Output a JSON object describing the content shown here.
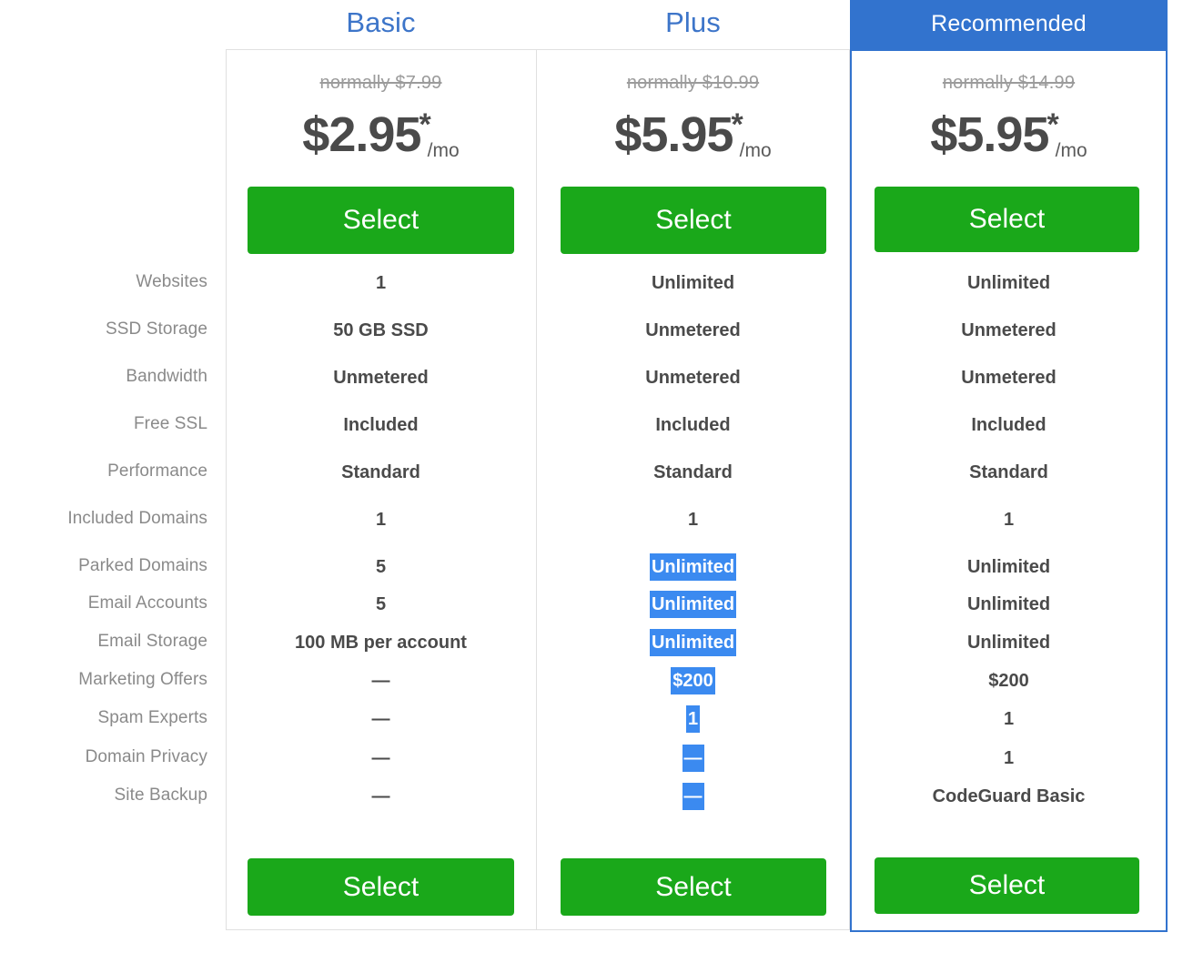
{
  "colors": {
    "brand_blue": "#3273ce",
    "title_blue": "#3d75c9",
    "select_green": "#1aa81a",
    "selection_highlight": "#3b8af0",
    "label_gray": "#8a8a8a",
    "value_gray": "#4a4a4a",
    "strike_gray": "#9b9b9b"
  },
  "plans": [
    {
      "id": "basic",
      "title": "Basic",
      "header_style": "plain",
      "normally": "normally $7.99",
      "price": "$2.95",
      "star": "*",
      "per": "/mo",
      "select_top_label": "Select",
      "select_bottom_label": "Select"
    },
    {
      "id": "plus",
      "title": "Plus",
      "header_style": "plain",
      "normally": "normally $10.99",
      "price": "$5.95",
      "star": "*",
      "per": "/mo",
      "select_top_label": "Select",
      "select_bottom_label": "Select"
    },
    {
      "id": "recommended",
      "title": "Recommended",
      "header_style": "highlighted",
      "normally": "normally $14.99",
      "price": "$5.95",
      "star": "*",
      "per": "/mo",
      "select_top_label": "Select",
      "select_bottom_label": "Select"
    }
  ],
  "features": [
    {
      "label": "Websites",
      "basic": "1",
      "plus": "Unlimited",
      "recommended": "Unlimited",
      "plus_selected": false
    },
    {
      "label": "SSD Storage",
      "basic": "50 GB SSD",
      "plus": "Unmetered",
      "recommended": "Unmetered",
      "plus_selected": false
    },
    {
      "label": "Bandwidth",
      "basic": "Unmetered",
      "plus": "Unmetered",
      "recommended": "Unmetered",
      "plus_selected": false
    },
    {
      "label": "Free SSL",
      "basic": "Included",
      "plus": "Included",
      "recommended": "Included",
      "plus_selected": false
    },
    {
      "label": "Performance",
      "basic": "Standard",
      "plus": "Standard",
      "recommended": "Standard",
      "plus_selected": false
    },
    {
      "label": "Included Domains",
      "basic": "1",
      "plus": "1",
      "recommended": "1",
      "plus_selected": false
    },
    {
      "label": "Parked Domains",
      "basic": "5",
      "plus": "Unlimited",
      "recommended": "Unlimited",
      "plus_selected": true
    },
    {
      "label": "Email Accounts",
      "basic": "5",
      "plus": "Unlimited",
      "recommended": "Unlimited",
      "plus_selected": true
    },
    {
      "label": "Email Storage",
      "basic": "100 MB per account",
      "plus": "Unlimited",
      "recommended": "Unlimited",
      "plus_selected": true
    },
    {
      "label": "Marketing Offers",
      "basic": "—",
      "plus": "$200",
      "recommended": "$200",
      "plus_selected": true
    },
    {
      "label": "Spam Experts",
      "basic": "—",
      "plus": "1",
      "recommended": "1",
      "plus_selected": true
    },
    {
      "label": "Domain Privacy",
      "basic": "—",
      "plus": "—",
      "recommended": "1",
      "plus_selected": true
    },
    {
      "label": "Site Backup",
      "basic": "—",
      "plus": "—",
      "recommended": "CodeGuard Basic",
      "plus_selected": true
    }
  ]
}
